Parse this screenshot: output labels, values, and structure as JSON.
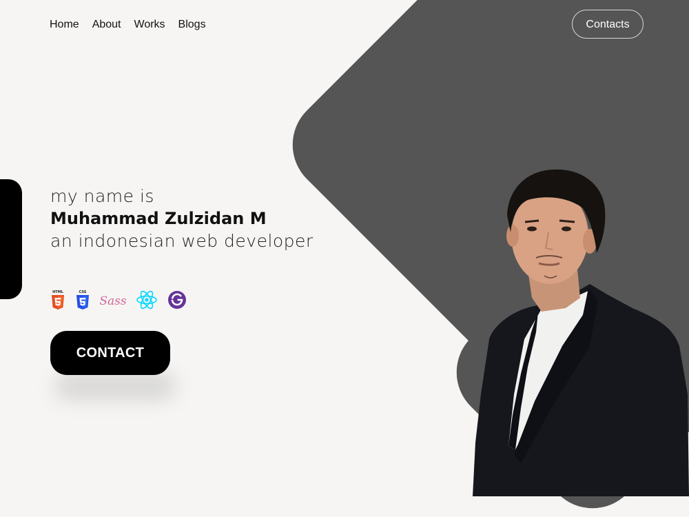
{
  "nav": {
    "items": [
      {
        "label": "Home"
      },
      {
        "label": "About"
      },
      {
        "label": "Works"
      },
      {
        "label": "Blogs"
      }
    ],
    "contacts_label": "Contacts"
  },
  "hero": {
    "line1": "my name is",
    "name": "Muhammad Zulzidan M",
    "line3": "an indonesian web developer",
    "cta_label": "CONTACT"
  },
  "tech_icons": [
    {
      "name": "html5-icon",
      "text": "HTML",
      "color": "#e44d26"
    },
    {
      "name": "css3-icon",
      "text": "CSS",
      "color": "#264de4"
    },
    {
      "name": "sass-icon",
      "text": "Sass",
      "color": "#cd6799"
    },
    {
      "name": "react-icon",
      "color": "#00d8ff"
    },
    {
      "name": "gatsby-icon",
      "color": "#663399"
    }
  ],
  "colors": {
    "background": "#f6f5f3",
    "shape": "#555555",
    "primary_text": "#111111",
    "button": "#000000"
  }
}
